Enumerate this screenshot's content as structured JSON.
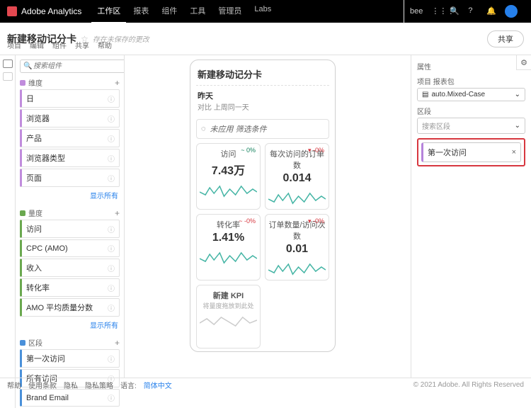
{
  "topbar": {
    "brand": "Adobe Analytics",
    "nav": [
      "工作区",
      "报表",
      "组件",
      "工具",
      "管理员",
      "Labs"
    ],
    "active": 0,
    "user": "bee"
  },
  "subbar": {
    "title": "新建移动记分卡",
    "unsaved": "存在未保存的更改",
    "share": "共享",
    "menu": [
      "项目",
      "编辑",
      "组件",
      "共享",
      "帮助"
    ]
  },
  "left": {
    "search_placeholder": "搜索组件",
    "show_all": "显示所有",
    "sections": [
      {
        "label": "维度",
        "color": "#c08cdc",
        "items": [
          "日",
          "浏览器",
          "产品",
          "浏览器类型",
          "页面"
        ]
      },
      {
        "label": "量度",
        "color": "#6aa84f",
        "items": [
          "访问",
          "CPC (AMO)",
          "收入",
          "转化率",
          "AMO 平均质量分数"
        ]
      },
      {
        "label": "区段",
        "color": "#4a90d9",
        "items": [
          "第一次访问",
          "所有访问",
          "Brand Email"
        ]
      }
    ]
  },
  "phone": {
    "title": "新建移动记分卡",
    "date1": "昨天",
    "date2": "对比 上周同一天",
    "filter_hint": "未应用 筛选条件",
    "cards": [
      {
        "metric": "访问",
        "value": "7.43万",
        "delta": "~ 0%",
        "dir": "pos"
      },
      {
        "metric": "每次访问的订单数",
        "value": "0.014",
        "delta": "▾ -0%",
        "dir": "neg"
      },
      {
        "metric": "转化率",
        "value": "1.41%",
        "delta": "~ -0%",
        "dir": "neg"
      },
      {
        "metric": "订单数量/访问次数",
        "value": "0.01",
        "delta": "▾ -0%",
        "dir": "neg"
      }
    ],
    "empty": {
      "title": "新建 KPI",
      "hint": "将量度拖放到此处"
    }
  },
  "right": {
    "header": "属性",
    "rs_label": "项目 报表包",
    "rs_value": "auto.Mixed-Case",
    "seg_label": "区段",
    "seg_placeholder": "搜索区段",
    "applied_segment": "第一次访问"
  },
  "footer": {
    "links": [
      "帮助",
      "使用条款",
      "隐私",
      "隐私策略"
    ],
    "lang_label": "语言:",
    "lang": "简体中文",
    "copy": "© 2021 Adobe. All Rights Reserved"
  }
}
